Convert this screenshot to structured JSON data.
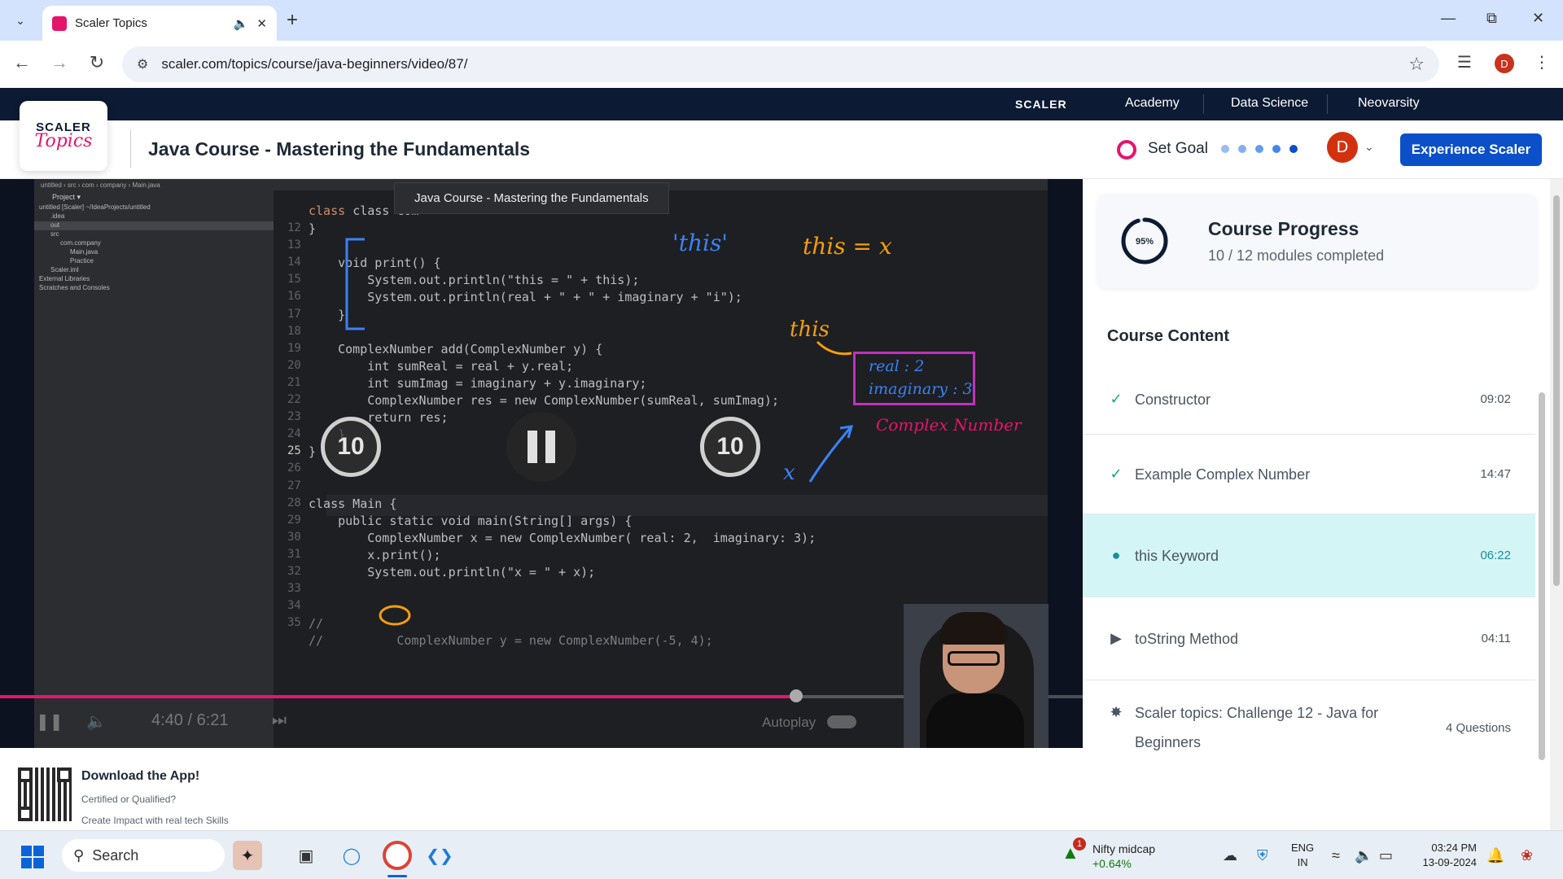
{
  "browser": {
    "tab_title": "Scaler Topics",
    "url": "scaler.com/topics/course/java-beginners/video/87/",
    "profile_initial": "D"
  },
  "site_nav": {
    "brand": "SCALER",
    "links": [
      "Academy",
      "Data Science",
      "Neovarsity"
    ]
  },
  "header": {
    "logo_top": "SCALER",
    "logo_bottom": "Topics",
    "course_title": "Java Course - Mastering the Fundamentals",
    "set_goal": "Set Goal",
    "avatar_initial": "D",
    "cta": "Experience Scaler"
  },
  "video": {
    "tooltip": "Java Course - Mastering the Fundamentals",
    "skip_back": "10",
    "skip_forward": "10",
    "time_current": "4:40",
    "time_total": "6:21",
    "progress_fraction": 0.735,
    "autoplay_label": "Autoplay",
    "annotations": {
      "this_quote": "'this'",
      "this_eq_x": "this = x",
      "this_label": "this",
      "box_real": "real : 2",
      "box_imag": "imaginary : 3",
      "box_caption": "Complex Number",
      "x_label": "x"
    },
    "code_lines": [
      {
        "n": "12",
        "text": "}"
      },
      {
        "n": "13",
        "text": ""
      },
      {
        "n": "14",
        "text": "    void print() {"
      },
      {
        "n": "15",
        "text": "        System.out.println(\"this = \" + this);"
      },
      {
        "n": "16",
        "text": "        System.out.println(real + \" + \" + imaginary + \"i\");"
      },
      {
        "n": "17",
        "text": "    }"
      },
      {
        "n": "18",
        "text": ""
      },
      {
        "n": "19",
        "text": "    ComplexNumber add(ComplexNumber y) {"
      },
      {
        "n": "20",
        "text": "        int sumReal = real + y.real;"
      },
      {
        "n": "21",
        "text": "        int sumImag = imaginary + y.imaginary;"
      },
      {
        "n": "22",
        "text": "        ComplexNumber res = new ComplexNumber(sumReal, sumImag);"
      },
      {
        "n": "23",
        "text": "        return res;"
      },
      {
        "n": "24",
        "text": "    }"
      },
      {
        "n": "25",
        "text": "}"
      },
      {
        "n": "26",
        "text": ""
      },
      {
        "n": "27",
        "text": ""
      },
      {
        "n": "28",
        "text": "class Main {"
      },
      {
        "n": "29",
        "text": "    public static void main(String[] args) {"
      },
      {
        "n": "30",
        "text": "        ComplexNumber x = new ComplexNumber( real: 2,  imaginary: 3);"
      },
      {
        "n": "31",
        "text": "        x.print();"
      },
      {
        "n": "32",
        "text": "        System.out.println(\"x = \" + x);"
      },
      {
        "n": "33",
        "text": ""
      },
      {
        "n": "34",
        "text": ""
      },
      {
        "n": "35",
        "text": "//"
      },
      {
        "n": "",
        "text": "//          ComplexNumber y = new ComplexNumber(-5, 4);"
      }
    ],
    "first_line_text": "class Com",
    "project_tree": [
      "untitled [Scaler]  ~/IdeaProjects/untitled",
      ".idea",
      "out",
      "src",
      "com.company",
      "Main.java",
      "Practice",
      "Scaler.iml",
      "External Libraries",
      "Scratches and Consoles"
    ]
  },
  "sidebar": {
    "progress_title": "Course Progress",
    "progress_percent_label": "95%",
    "progress_percent": 95,
    "progress_sub": "10 / 12 modules completed",
    "content_title": "Course Content",
    "lessons": [
      {
        "label": "Constructor",
        "time": "09:02",
        "status": "completed"
      },
      {
        "label": "Example Complex Number",
        "time": "14:47",
        "status": "completed"
      },
      {
        "label": "this Keyword",
        "time": "06:22",
        "status": "playing"
      },
      {
        "label": "toString Method",
        "time": "04:11",
        "status": "not-started"
      },
      {
        "label": "Scaler topics: Challenge 12 - Java for Beginners",
        "time": "4 Questions",
        "status": "challenge"
      }
    ]
  },
  "download": {
    "title": "Download the App!",
    "sub1": "Certified or Qualified?",
    "sub2": "Create Impact with real tech Skills"
  },
  "taskbar": {
    "search": "Search",
    "weather_badge": "1",
    "weather_title": "Nifty midcap",
    "weather_value": "+0.64%",
    "lang1": "ENG",
    "lang2": "IN",
    "time": "03:24 PM",
    "date": "13-09-2024"
  },
  "colors": {
    "brand_pink": "#e5156b",
    "nav_dark": "#0c1b33",
    "cta_blue": "#0b50c8",
    "active_lesson_bg": "#d4f5f5",
    "completed_green": "#1aa37a"
  }
}
